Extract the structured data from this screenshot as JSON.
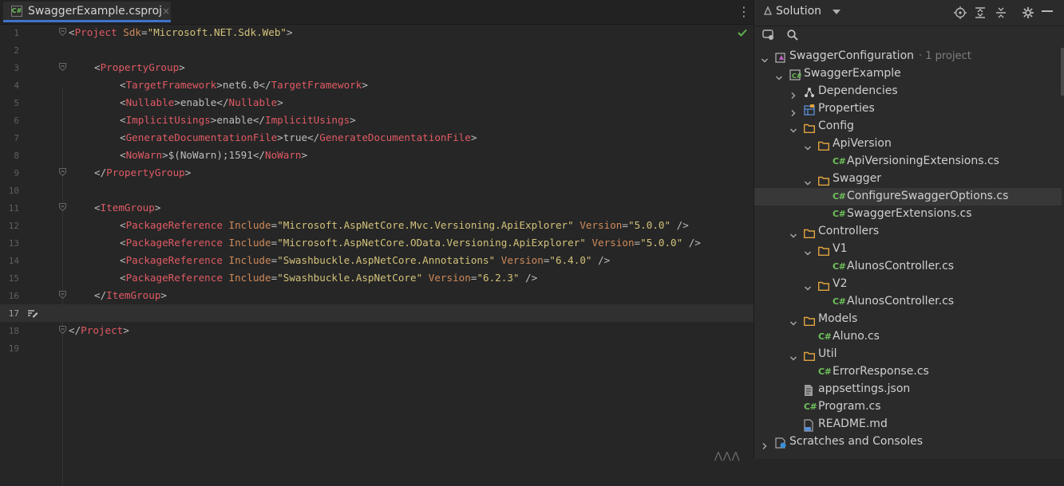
{
  "editor": {
    "tab": {
      "icon": "csharp-project-icon",
      "badge": "C#",
      "label": "SwaggerExample.csproj",
      "close": "×"
    },
    "more_icon": "vertical-ellipsis-icon",
    "lines": [
      {
        "n": "1",
        "indent": 0,
        "tokens": [
          [
            "bracket",
            "<"
          ],
          [
            "tag",
            "Project"
          ],
          [
            "text",
            " "
          ],
          [
            "attr",
            "Sdk"
          ],
          [
            "text",
            "="
          ],
          [
            "val",
            "\"Microsoft.NET.Sdk.Web\""
          ],
          [
            "bracket",
            ">"
          ]
        ]
      },
      {
        "n": "2",
        "indent": 0,
        "tokens": []
      },
      {
        "n": "3",
        "indent": 1,
        "tokens": [
          [
            "bracket",
            "<"
          ],
          [
            "tag",
            "PropertyGroup"
          ],
          [
            "bracket",
            ">"
          ]
        ]
      },
      {
        "n": "4",
        "indent": 2,
        "tokens": [
          [
            "bracket",
            "<"
          ],
          [
            "tag",
            "TargetFramework"
          ],
          [
            "bracket",
            ">"
          ],
          [
            "text",
            "net6.0"
          ],
          [
            "bracket",
            "</"
          ],
          [
            "tag",
            "TargetFramework"
          ],
          [
            "bracket",
            ">"
          ]
        ]
      },
      {
        "n": "5",
        "indent": 2,
        "tokens": [
          [
            "bracket",
            "<"
          ],
          [
            "tag",
            "Nullable"
          ],
          [
            "bracket",
            ">"
          ],
          [
            "text",
            "enable"
          ],
          [
            "bracket",
            "</"
          ],
          [
            "tag",
            "Nullable"
          ],
          [
            "bracket",
            ">"
          ]
        ]
      },
      {
        "n": "6",
        "indent": 2,
        "tokens": [
          [
            "bracket",
            "<"
          ],
          [
            "tag",
            "ImplicitUsings"
          ],
          [
            "bracket",
            ">"
          ],
          [
            "text",
            "enable"
          ],
          [
            "bracket",
            "</"
          ],
          [
            "tag",
            "ImplicitUsings"
          ],
          [
            "bracket",
            ">"
          ]
        ]
      },
      {
        "n": "7",
        "indent": 2,
        "tokens": [
          [
            "bracket",
            "<"
          ],
          [
            "tag",
            "GenerateDocumentationFile"
          ],
          [
            "bracket",
            ">"
          ],
          [
            "text",
            "true"
          ],
          [
            "bracket",
            "</"
          ],
          [
            "tag",
            "GenerateDocumentationFile"
          ],
          [
            "bracket",
            ">"
          ]
        ]
      },
      {
        "n": "8",
        "indent": 2,
        "tokens": [
          [
            "bracket",
            "<"
          ],
          [
            "tag",
            "NoWarn"
          ],
          [
            "bracket",
            ">"
          ],
          [
            "text",
            "$(NoWarn);1591"
          ],
          [
            "bracket",
            "</"
          ],
          [
            "tag",
            "NoWarn"
          ],
          [
            "bracket",
            ">"
          ]
        ]
      },
      {
        "n": "9",
        "indent": 1,
        "tokens": [
          [
            "bracket",
            "</"
          ],
          [
            "tag",
            "PropertyGroup"
          ],
          [
            "bracket",
            ">"
          ]
        ]
      },
      {
        "n": "10",
        "indent": 0,
        "tokens": []
      },
      {
        "n": "11",
        "indent": 1,
        "tokens": [
          [
            "bracket",
            "<"
          ],
          [
            "tag",
            "ItemGroup"
          ],
          [
            "bracket",
            ">"
          ]
        ]
      },
      {
        "n": "12",
        "indent": 2,
        "tokens": [
          [
            "bracket",
            "<"
          ],
          [
            "tag",
            "PackageReference"
          ],
          [
            "text",
            " "
          ],
          [
            "attr",
            "Include"
          ],
          [
            "text",
            "="
          ],
          [
            "val",
            "\"Microsoft.AspNetCore.Mvc.Versioning.ApiExplorer\""
          ],
          [
            "text",
            " "
          ],
          [
            "attr",
            "Version"
          ],
          [
            "text",
            "="
          ],
          [
            "val",
            "\"5.0.0\""
          ],
          [
            "text",
            " "
          ],
          [
            "bracket",
            "/>"
          ]
        ]
      },
      {
        "n": "13",
        "indent": 2,
        "tokens": [
          [
            "bracket",
            "<"
          ],
          [
            "tag",
            "PackageReference"
          ],
          [
            "text",
            " "
          ],
          [
            "attr",
            "Include"
          ],
          [
            "text",
            "="
          ],
          [
            "val",
            "\"Microsoft.AspNetCore.OData.Versioning.ApiExplorer\""
          ],
          [
            "text",
            " "
          ],
          [
            "attr",
            "Version"
          ],
          [
            "text",
            "="
          ],
          [
            "val",
            "\"5.0.0\""
          ],
          [
            "text",
            " "
          ],
          [
            "bracket",
            "/>"
          ]
        ]
      },
      {
        "n": "14",
        "indent": 2,
        "tokens": [
          [
            "bracket",
            "<"
          ],
          [
            "tag",
            "PackageReference"
          ],
          [
            "text",
            " "
          ],
          [
            "attr",
            "Include"
          ],
          [
            "text",
            "="
          ],
          [
            "val",
            "\"Swashbuckle.AspNetCore.Annotations\""
          ],
          [
            "text",
            " "
          ],
          [
            "attr",
            "Version"
          ],
          [
            "text",
            "="
          ],
          [
            "val",
            "\"6.4.0\""
          ],
          [
            "text",
            " "
          ],
          [
            "bracket",
            "/>"
          ]
        ]
      },
      {
        "n": "15",
        "indent": 2,
        "tokens": [
          [
            "bracket",
            "<"
          ],
          [
            "tag",
            "PackageReference"
          ],
          [
            "text",
            " "
          ],
          [
            "attr",
            "Include"
          ],
          [
            "text",
            "="
          ],
          [
            "val",
            "\"Swashbuckle.AspNetCore\""
          ],
          [
            "text",
            " "
          ],
          [
            "attr",
            "Version"
          ],
          [
            "text",
            "="
          ],
          [
            "val",
            "\"6.2.3\""
          ],
          [
            "text",
            " "
          ],
          [
            "bracket",
            "/>"
          ]
        ]
      },
      {
        "n": "16",
        "indent": 1,
        "tokens": [
          [
            "bracket",
            "</"
          ],
          [
            "tag",
            "ItemGroup"
          ],
          [
            "bracket",
            ">"
          ]
        ]
      },
      {
        "n": "17",
        "indent": 0,
        "tokens": [],
        "current": true
      },
      {
        "n": "18",
        "indent": 0,
        "tokens": [
          [
            "bracket",
            "</"
          ],
          [
            "tag",
            "Project"
          ],
          [
            "bracket",
            ">"
          ]
        ]
      },
      {
        "n": "19",
        "indent": 0,
        "tokens": []
      }
    ],
    "fold_lines": [
      "1",
      "3",
      "9",
      "11",
      "16",
      "18"
    ],
    "status_icon": "checkmark-icon"
  },
  "solution": {
    "title": "Solution",
    "toolbar_icons": [
      "locate-icon",
      "expand-all-icon",
      "collapse-all-icon",
      "gear-icon",
      "minimize-icon"
    ],
    "search_icon": "search-icon",
    "filter_icon": "show-files-icon",
    "tree": [
      {
        "depth": 0,
        "arrow": "down",
        "icon": "solution-icon",
        "label": "SwaggerConfiguration",
        "sub": "· 1 project"
      },
      {
        "depth": 1,
        "arrow": "down",
        "icon": "csharp-project-icon",
        "label": "SwaggerExample"
      },
      {
        "depth": 2,
        "arrow": "right",
        "icon": "dependencies-icon",
        "label": "Dependencies"
      },
      {
        "depth": 2,
        "arrow": "right",
        "icon": "properties-icon",
        "label": "Properties"
      },
      {
        "depth": 2,
        "arrow": "down",
        "icon": "folder-icon",
        "label": "Config"
      },
      {
        "depth": 3,
        "arrow": "down",
        "icon": "folder-icon",
        "label": "ApiVersion"
      },
      {
        "depth": 4,
        "arrow": "none",
        "icon": "csharp-file-icon",
        "label": "ApiVersioningExtensions.cs"
      },
      {
        "depth": 3,
        "arrow": "down",
        "icon": "folder-icon",
        "label": "Swagger"
      },
      {
        "depth": 4,
        "arrow": "none",
        "icon": "csharp-file-icon",
        "label": "ConfigureSwaggerOptions.cs",
        "selected": true
      },
      {
        "depth": 4,
        "arrow": "none",
        "icon": "csharp-file-icon",
        "label": "SwaggerExtensions.cs"
      },
      {
        "depth": 2,
        "arrow": "down",
        "icon": "folder-icon",
        "label": "Controllers"
      },
      {
        "depth": 3,
        "arrow": "down",
        "icon": "folder-icon",
        "label": "V1"
      },
      {
        "depth": 4,
        "arrow": "none",
        "icon": "csharp-file-icon",
        "label": "AlunosController.cs"
      },
      {
        "depth": 3,
        "arrow": "down",
        "icon": "folder-icon",
        "label": "V2"
      },
      {
        "depth": 4,
        "arrow": "none",
        "icon": "csharp-file-icon",
        "label": "AlunosController.cs"
      },
      {
        "depth": 2,
        "arrow": "down",
        "icon": "folder-icon",
        "label": "Models"
      },
      {
        "depth": 3,
        "arrow": "none",
        "icon": "csharp-file-icon",
        "label": "Aluno.cs"
      },
      {
        "depth": 2,
        "arrow": "down",
        "icon": "folder-icon",
        "label": "Util"
      },
      {
        "depth": 3,
        "arrow": "none",
        "icon": "csharp-file-icon",
        "label": "ErrorResponse.cs"
      },
      {
        "depth": 2,
        "arrow": "none",
        "icon": "json-file-icon",
        "label": "appsettings.json"
      },
      {
        "depth": 2,
        "arrow": "none",
        "icon": "csharp-file-icon",
        "label": "Program.cs"
      },
      {
        "depth": 2,
        "arrow": "none",
        "icon": "markdown-file-icon",
        "label": "README.md"
      },
      {
        "depth": 0,
        "arrow": "right",
        "icon": "scratches-icon",
        "label": "Scratches and Consoles"
      }
    ]
  },
  "colors": {
    "tag": "#e05a64",
    "attr": "#cf8a5a",
    "value": "#d3c27a",
    "csharp": "#6ec15a",
    "folder": "#e0a340",
    "tab_underline": "#3f74c9"
  }
}
